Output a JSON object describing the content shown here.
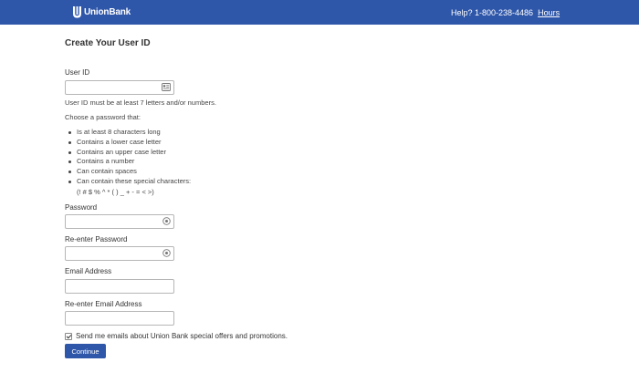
{
  "header": {
    "brand": "UnionBank",
    "help_text": "Help? 1-800-238-4486",
    "hours_link": "Hours",
    "bg_color": "#2e56a9"
  },
  "form": {
    "title": "Create Your User ID",
    "user_id": {
      "label": "User ID",
      "value": "",
      "icon": "contact-card-icon",
      "hint": "User ID must be at least 7 letters and/or numbers."
    },
    "password_intro": "Choose a password that:",
    "password_rules": [
      "Is at least 8 characters long",
      "Contains a lower case letter",
      "Contains an upper case letter",
      "Contains a number",
      "Can contain spaces",
      "Can contain these special characters:"
    ],
    "special_characters": "(! # $ % ^ * ( ) _ + - = < >)",
    "password": {
      "label": "Password",
      "value": "",
      "icon": "eye-icon"
    },
    "reenter_password": {
      "label": "Re-enter Password",
      "value": "",
      "icon": "eye-icon"
    },
    "email": {
      "label": "Email Address",
      "value": ""
    },
    "reenter_email": {
      "label": "Re-enter Email Address",
      "value": ""
    },
    "offers_checkbox": {
      "label": "Send me emails about Union Bank special offers and promotions.",
      "checked": true
    },
    "continue_button": "Continue"
  }
}
